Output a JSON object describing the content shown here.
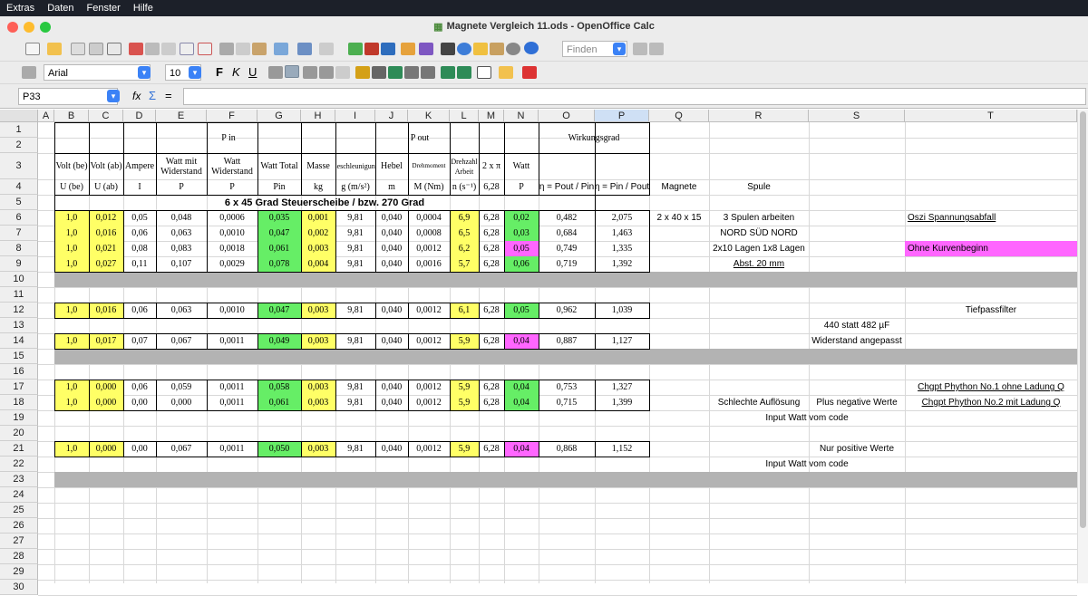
{
  "menubar": [
    "Extras",
    "Daten",
    "Fenster",
    "Hilfe"
  ],
  "window": {
    "title": "Magnete Vergleich 11.ods - OpenOffice Calc"
  },
  "toolbar": {
    "find_placeholder": "Finden"
  },
  "format": {
    "font_name": "Arial",
    "font_size": "10",
    "bold": "F",
    "italic": "K",
    "underline": "U"
  },
  "formula_bar": {
    "cell_ref": "P33",
    "fx": "fx",
    "sum": "Σ",
    "eq": "=",
    "content": ""
  },
  "columns": [
    "A",
    "B",
    "C",
    "D",
    "E",
    "F",
    "G",
    "H",
    "I",
    "J",
    "K",
    "L",
    "M",
    "N",
    "O",
    "P",
    "Q",
    "R",
    "S",
    "T"
  ],
  "rows": [
    "1",
    "2",
    "3",
    "4",
    "5",
    "6",
    "7",
    "8",
    "9",
    "10",
    "11",
    "12",
    "13",
    "14",
    "15",
    "16",
    "17",
    "18",
    "19",
    "20",
    "21",
    "22",
    "23",
    "24",
    "25",
    "26",
    "27",
    "28",
    "29",
    "30"
  ],
  "headers": {
    "p_in": "P in",
    "p_out": "P out",
    "wirkungsgrad": "Wirkungsgrad",
    "r3": [
      "Volt (be)",
      "Volt (ab)",
      "Ampere",
      "Watt mit Widerstand",
      "Watt Widerstand",
      "Watt Total",
      "Masse",
      "Beschleunigung",
      "Hebel",
      "Drehmoment",
      "Drehzahl Arbeit",
      "2 x π",
      "Watt"
    ],
    "r4": [
      "U (be)",
      "U (ab)",
      "I",
      "P",
      "P",
      "Pin",
      "kg",
      "g (m/s²)",
      "m",
      "M (Nm)",
      "n (s⁻¹)",
      "6,28",
      "P",
      "η = Pout / Pin",
      "η = Pin / Pout",
      "Magnete",
      "Spule"
    ],
    "title": "6 x 45 Grad Steuerscheibe / bzw. 270 Grad"
  },
  "data": {
    "r6": [
      "1,0",
      "0,012",
      "0,05",
      "0,048",
      "0,0006",
      "0,035",
      "0,001",
      "9,81",
      "0,040",
      "0,0004",
      "6,9",
      "6,28",
      "0,02",
      "0,482",
      "2,075"
    ],
    "r7": [
      "1,0",
      "0,016",
      "0,06",
      "0,063",
      "0,0010",
      "0,047",
      "0,002",
      "9,81",
      "0,040",
      "0,0008",
      "6,5",
      "6,28",
      "0,03",
      "0,684",
      "1,463"
    ],
    "r8": [
      "1,0",
      "0,021",
      "0,08",
      "0,083",
      "0,0018",
      "0,061",
      "0,003",
      "9,81",
      "0,040",
      "0,0012",
      "6,2",
      "6,28",
      "0,05",
      "0,749",
      "1,335"
    ],
    "r9": [
      "1,0",
      "0,027",
      "0,11",
      "0,107",
      "0,0029",
      "0,078",
      "0,004",
      "9,81",
      "0,040",
      "0,0016",
      "5,7",
      "6,28",
      "0,06",
      "0,719",
      "1,392"
    ],
    "r12": [
      "1,0",
      "0,016",
      "0,06",
      "0,063",
      "0,0010",
      "0,047",
      "0,003",
      "9,81",
      "0,040",
      "0,0012",
      "6,1",
      "6,28",
      "0,05",
      "0,962",
      "1,039"
    ],
    "r14": [
      "1,0",
      "0,017",
      "0,07",
      "0,067",
      "0,0011",
      "0,049",
      "0,003",
      "9,81",
      "0,040",
      "0,0012",
      "5,9",
      "6,28",
      "0,04",
      "0,887",
      "1,127"
    ],
    "r17": [
      "1,0",
      "0,000",
      "0,06",
      "0,059",
      "0,0011",
      "0,058",
      "0,003",
      "9,81",
      "0,040",
      "0,0012",
      "5,9",
      "6,28",
      "0,04",
      "0,753",
      "1,327"
    ],
    "r18": [
      "1,0",
      "0,000",
      "0,00",
      "0,000",
      "0,0011",
      "0,061",
      "0,003",
      "9,81",
      "0,040",
      "0,0012",
      "5,9",
      "6,28",
      "0,04",
      "0,715",
      "1,399"
    ],
    "r21": [
      "1,0",
      "0,000",
      "0,00",
      "0,067",
      "0,0011",
      "0,050",
      "0,003",
      "9,81",
      "0,040",
      "0,0012",
      "5,9",
      "6,28",
      "0,04",
      "0,868",
      "1,152"
    ]
  },
  "notes": {
    "q6": "2 x 40 x 15",
    "r6": "3 Spulen arbeiten",
    "r7": "NORD SÜD NORD",
    "r8": "2x10 Lagen 1x8 Lagen",
    "r9": "Abst. 20 mm",
    "t6": "Oszi Spannungsabfall",
    "t8": "Ohne Kurvenbeginn",
    "t12": "Tiefpassfilter",
    "s13": "440 statt 482 µF",
    "s14": "Widerstand angepasst",
    "t17": "Chgpt Phython No.1 ohne Ladung Q",
    "r18": "Schlechte Auflösung",
    "s18": "Plus negative Werte",
    "t18": "Chgpt Phython No.2 mit Ladung Q",
    "rs19": "Input Watt vom code",
    "s21": "Nur positive Werte",
    "rs22": "Input Watt vom code"
  },
  "colors": {
    "yellow": "#ffff66",
    "green": "#66ee66",
    "magenta": "#ff66ff",
    "gray": "#b3b3b3"
  }
}
